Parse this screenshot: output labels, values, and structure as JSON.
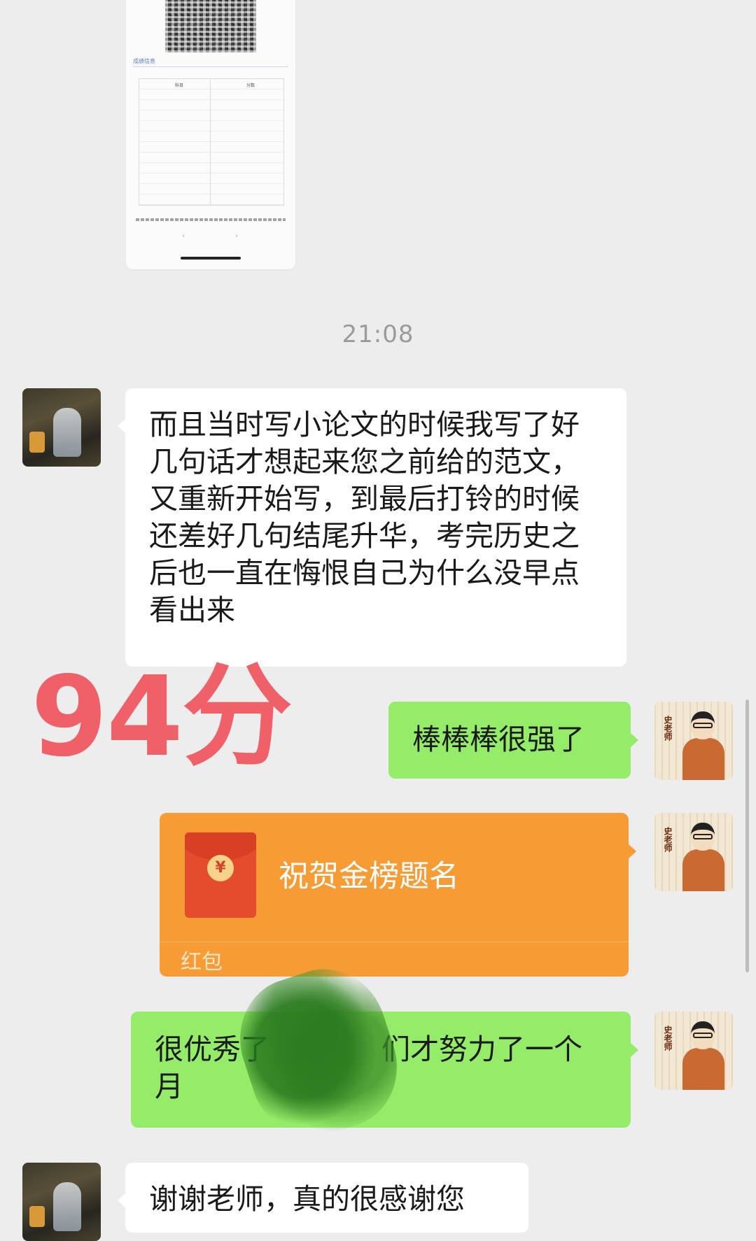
{
  "shared_image": {
    "section_title": "成绩信息",
    "table_header": [
      "科目",
      "分数"
    ],
    "nav_prev": "‹",
    "nav_next": "›"
  },
  "timestamp": "21:08",
  "messages": [
    {
      "side": "left",
      "type": "text",
      "text": "而且当时写小论文的时候我写了好几句话才想起来您之前给的范文，又重新开始写，到最后打铃的时候还差好几句结尾升华，考完历史之后也一直在悔恨自己为什么没早点看出来"
    },
    {
      "side": "right",
      "type": "text",
      "text": "棒棒棒很强了"
    },
    {
      "side": "right",
      "type": "red_packet",
      "title": "祝贺金榜题名",
      "label": "红包",
      "icon": "red-packet-icon"
    },
    {
      "side": "right",
      "type": "text",
      "text_start": "很优秀了",
      "text_end": "们才努力了一个月"
    },
    {
      "side": "left",
      "type": "text",
      "text": "谢谢老师，真的很感谢您"
    }
  ],
  "avatar_right_mark": "史老师",
  "overlay_score": "94分",
  "colors": {
    "background": "#ededed",
    "bubble_self": "#95ec69",
    "bubble_other": "#ffffff",
    "red_packet": "#f79c35",
    "score_overlay": "#f06068"
  }
}
